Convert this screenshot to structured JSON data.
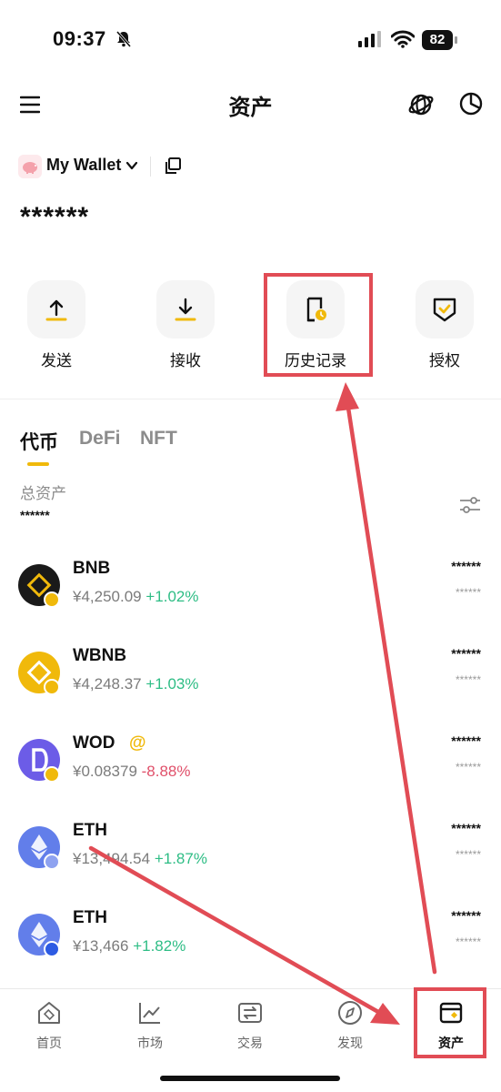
{
  "status": {
    "time": "09:37",
    "battery": "82"
  },
  "header": {
    "title": "资产"
  },
  "wallet": {
    "name": "My Wallet",
    "balance": "******"
  },
  "actions": [
    {
      "label": "发送",
      "icon": "upload-arrow-icon"
    },
    {
      "label": "接收",
      "icon": "download-arrow-icon"
    },
    {
      "label": "历史记录",
      "icon": "history-document-icon"
    },
    {
      "label": "授权",
      "icon": "authorize-shield-icon"
    }
  ],
  "tabs": [
    {
      "label": "代币",
      "active": true
    },
    {
      "label": "DeFi",
      "active": false
    },
    {
      "label": "NFT",
      "active": false
    }
  ],
  "assets": {
    "total_label": "总资产",
    "total_value": "******"
  },
  "tokens": [
    {
      "name": "BNB",
      "price": "¥4,250.09",
      "change": "+1.02%",
      "balance": "******",
      "value": "******",
      "color": "#1a1a1a"
    },
    {
      "name": "WBNB",
      "price": "¥4,248.37",
      "change": "+1.03%",
      "balance": "******",
      "value": "******",
      "color": "#f0b90b"
    },
    {
      "name": "WOD",
      "tag": "@",
      "price": "¥0.08379",
      "change": "-8.88%",
      "balance": "******",
      "value": "******",
      "color": "#6c5ce7"
    },
    {
      "name": "ETH",
      "price": "¥13,494.54",
      "change": "+1.87%",
      "balance": "******",
      "value": "******",
      "color": "#627eea"
    },
    {
      "name": "ETH",
      "price": "¥13,466",
      "change": "+1.82%",
      "balance": "******",
      "value": "******",
      "color": "#627eea"
    }
  ],
  "nav": [
    {
      "label": "首页",
      "icon": "home-icon"
    },
    {
      "label": "市场",
      "icon": "market-chart-icon"
    },
    {
      "label": "交易",
      "icon": "swap-icon"
    },
    {
      "label": "发现",
      "icon": "discover-compass-icon"
    },
    {
      "label": "资产",
      "icon": "wallet-icon",
      "active": true
    }
  ],
  "colors": {
    "accent": "#f0b90b",
    "positive": "#2ebd85",
    "negative": "#e0506a",
    "annotation": "#e14c55"
  }
}
